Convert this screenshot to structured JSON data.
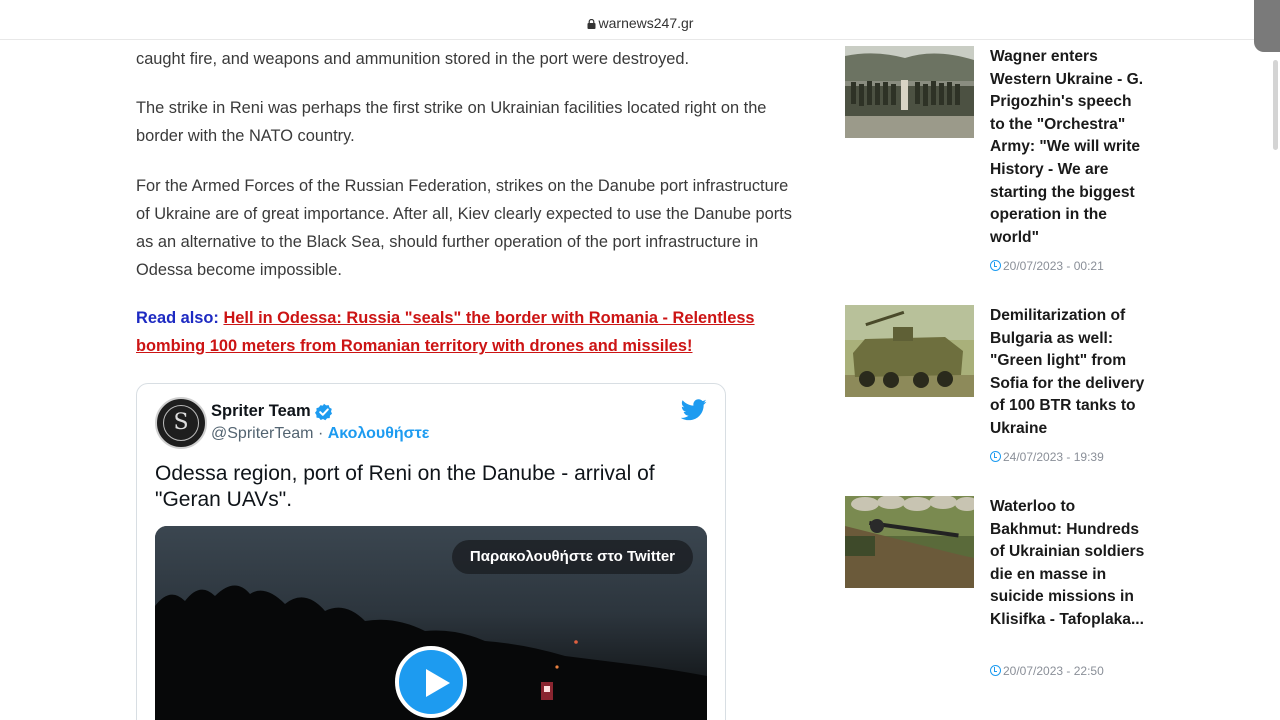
{
  "browser": {
    "url": "warnews247.gr"
  },
  "article": {
    "paragraphs": [
      "caught fire, and weapons and ammunition stored in the port were destroyed.",
      "The strike in Reni was perhaps the first strike on Ukrainian facilities located right on the border with the NATO country.",
      "For the Armed Forces of the Russian Federation, strikes on the Danube port infrastructure of Ukraine are of great importance. After all, Kiev clearly expected to use the Danube ports as an alternative to the Black Sea, should further operation of the port infrastructure in Odessa become impossible."
    ],
    "read_also": {
      "label": "Read also:",
      "link_text": "Hell in Odessa: Russia \"seals\" the border with Romania - Relentless bombing 100 meters from Romanian territory with drones and missiles!"
    }
  },
  "tweet": {
    "avatar_letter": "S",
    "name": "Spriter Team",
    "handle": "@SpriterTeam",
    "separator": "·",
    "follow_label": "Ακολουθήστε",
    "text": "Odessa region, port of Reni on the Danube - arrival of \"Geran UAVs\".",
    "watch_label": "Παρακολουθήστε στο Twitter",
    "icons": {
      "verified": "verified-badge-icon",
      "bird": "twitter-bird-icon",
      "play": "play-icon"
    },
    "accent_color": "#1d9bf0"
  },
  "sidebar": {
    "items": [
      {
        "title": "Wagner enters Western Ukraine - G. Prigozhin's speech to the \"Orchestra\" Army: \"We will write History - We are starting the biggest operation in the world\"",
        "date": "20/07/2023 - 00:21"
      },
      {
        "title": "Demilitarization of Bulgaria as well: \"Green light\" from Sofia for the delivery of 100 BTR tanks to Ukraine",
        "date": "24/07/2023 - 19:39"
      },
      {
        "title": "Waterloo to Bakhmut: Hundreds of Ukrainian soldiers die en masse in suicide missions in Klisifka - Tafoplaka...",
        "date": "20/07/2023 - 22:50"
      }
    ]
  },
  "colors": {
    "read_also_label": "#1d2ac2",
    "read_also_link": "#cc1414"
  }
}
